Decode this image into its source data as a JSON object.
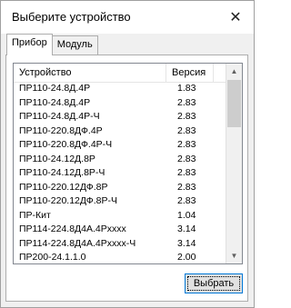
{
  "dialog": {
    "title": "Выберите устройство",
    "close_glyph": "✕"
  },
  "tabs": [
    {
      "label": "Прибор",
      "active": true
    },
    {
      "label": "Модуль",
      "active": false
    }
  ],
  "table": {
    "columns": [
      "Устройство",
      "Версия"
    ],
    "rows": [
      [
        "ПР110-24.8Д.4Р",
        "1.83"
      ],
      [
        "ПР110-24.8Д.4Р",
        "2.83"
      ],
      [
        "ПР110-24.8Д.4Р-Ч",
        "2.83"
      ],
      [
        "ПР110-220.8ДФ.4Р",
        "2.83"
      ],
      [
        "ПР110-220.8ДФ.4Р-Ч",
        "2.83"
      ],
      [
        "ПР110-24.12Д.8Р",
        "2.83"
      ],
      [
        "ПР110-24.12Д.8Р-Ч",
        "2.83"
      ],
      [
        "ПР110-220.12ДФ.8Р",
        "2.83"
      ],
      [
        "ПР110-220.12ДФ.8Р-Ч",
        "2.83"
      ],
      [
        "ПР-Кит",
        "1.04"
      ],
      [
        "ПР114-224.8Д4А.4Pxxxx",
        "3.14"
      ],
      [
        "ПР114-224.8Д4А.4Pxxxx-Ч",
        "3.14"
      ],
      [
        "ПР200-24.1.1.0",
        "2.00"
      ]
    ]
  },
  "scrollbar": {
    "up_glyph": "▲",
    "down_glyph": "▼"
  },
  "buttons": {
    "select_label": "Выбрать"
  }
}
